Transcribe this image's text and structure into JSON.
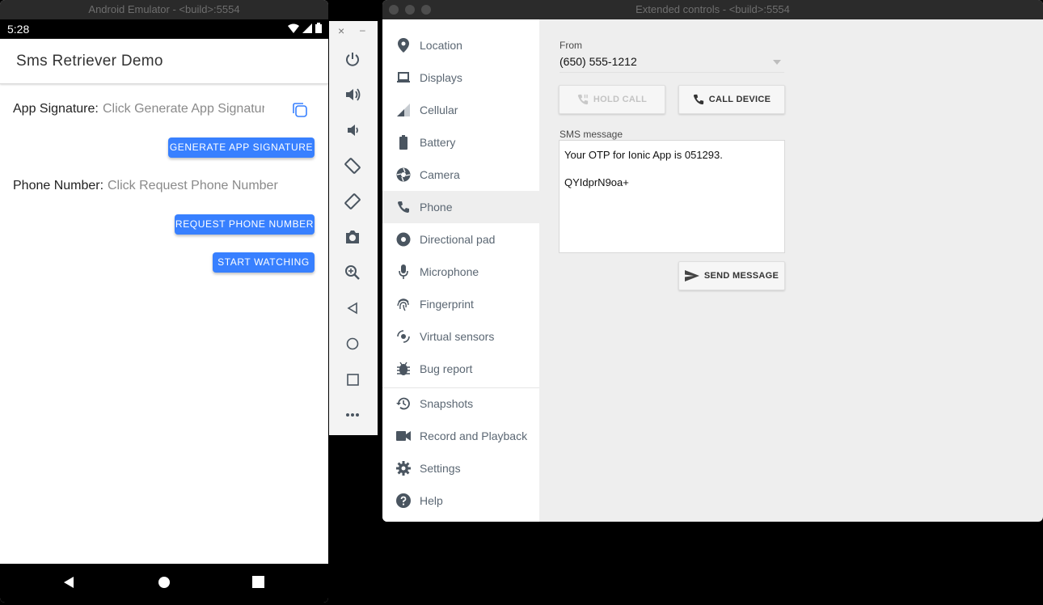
{
  "emulator": {
    "window_title": "Android Emulator - <build>:5554",
    "status_time": "5:28",
    "app_title": "Sms Retriever Demo",
    "app_signature_label": "App Signature:",
    "app_signature_value": "Click Generate App Signatur",
    "generate_button": "GENERATE APP SIGNATURE",
    "phone_label": "Phone Number:",
    "phone_value": "Click Request Phone Number",
    "request_button": "REQUEST PHONE NUMBER",
    "watch_button": "START WATCHING",
    "accent_color": "#3880ff"
  },
  "toolbar": {
    "close_glyph": "×",
    "minimize_glyph": "–",
    "icons": [
      "power-icon",
      "volume-up-icon",
      "volume-down-icon",
      "rotate-left-icon",
      "rotate-right-icon",
      "camera-icon",
      "zoom-icon",
      "back-icon",
      "home-icon",
      "overview-icon",
      "more-icon"
    ]
  },
  "extended": {
    "window_title": "Extended controls - <build>:5554",
    "sidebar": [
      {
        "label": "Location",
        "icon": "location-pin-icon"
      },
      {
        "label": "Displays",
        "icon": "display-icon"
      },
      {
        "label": "Cellular",
        "icon": "cellular-signal-icon"
      },
      {
        "label": "Battery",
        "icon": "battery-icon"
      },
      {
        "label": "Camera",
        "icon": "camera-aperture-icon"
      },
      {
        "label": "Phone",
        "icon": "phone-icon"
      },
      {
        "label": "Directional pad",
        "icon": "dpad-icon"
      },
      {
        "label": "Microphone",
        "icon": "microphone-icon"
      },
      {
        "label": "Fingerprint",
        "icon": "fingerprint-icon"
      },
      {
        "label": "Virtual sensors",
        "icon": "sensors-icon"
      },
      {
        "label": "Bug report",
        "icon": "bug-icon"
      },
      {
        "label": "Snapshots",
        "icon": "history-icon"
      },
      {
        "label": "Record and Playback",
        "icon": "video-icon"
      },
      {
        "label": "Settings",
        "icon": "gear-icon"
      },
      {
        "label": "Help",
        "icon": "help-icon"
      }
    ],
    "active_item": "Phone",
    "from_label": "From",
    "from_value": "(650) 555-1212",
    "hold_call": "HOLD CALL",
    "call_device": "CALL DEVICE",
    "sms_label": "SMS message",
    "sms_text": "Your OTP for Ionic App is 051293.\n\nQYIdprN9oa+",
    "send_message": "SEND MESSAGE"
  }
}
